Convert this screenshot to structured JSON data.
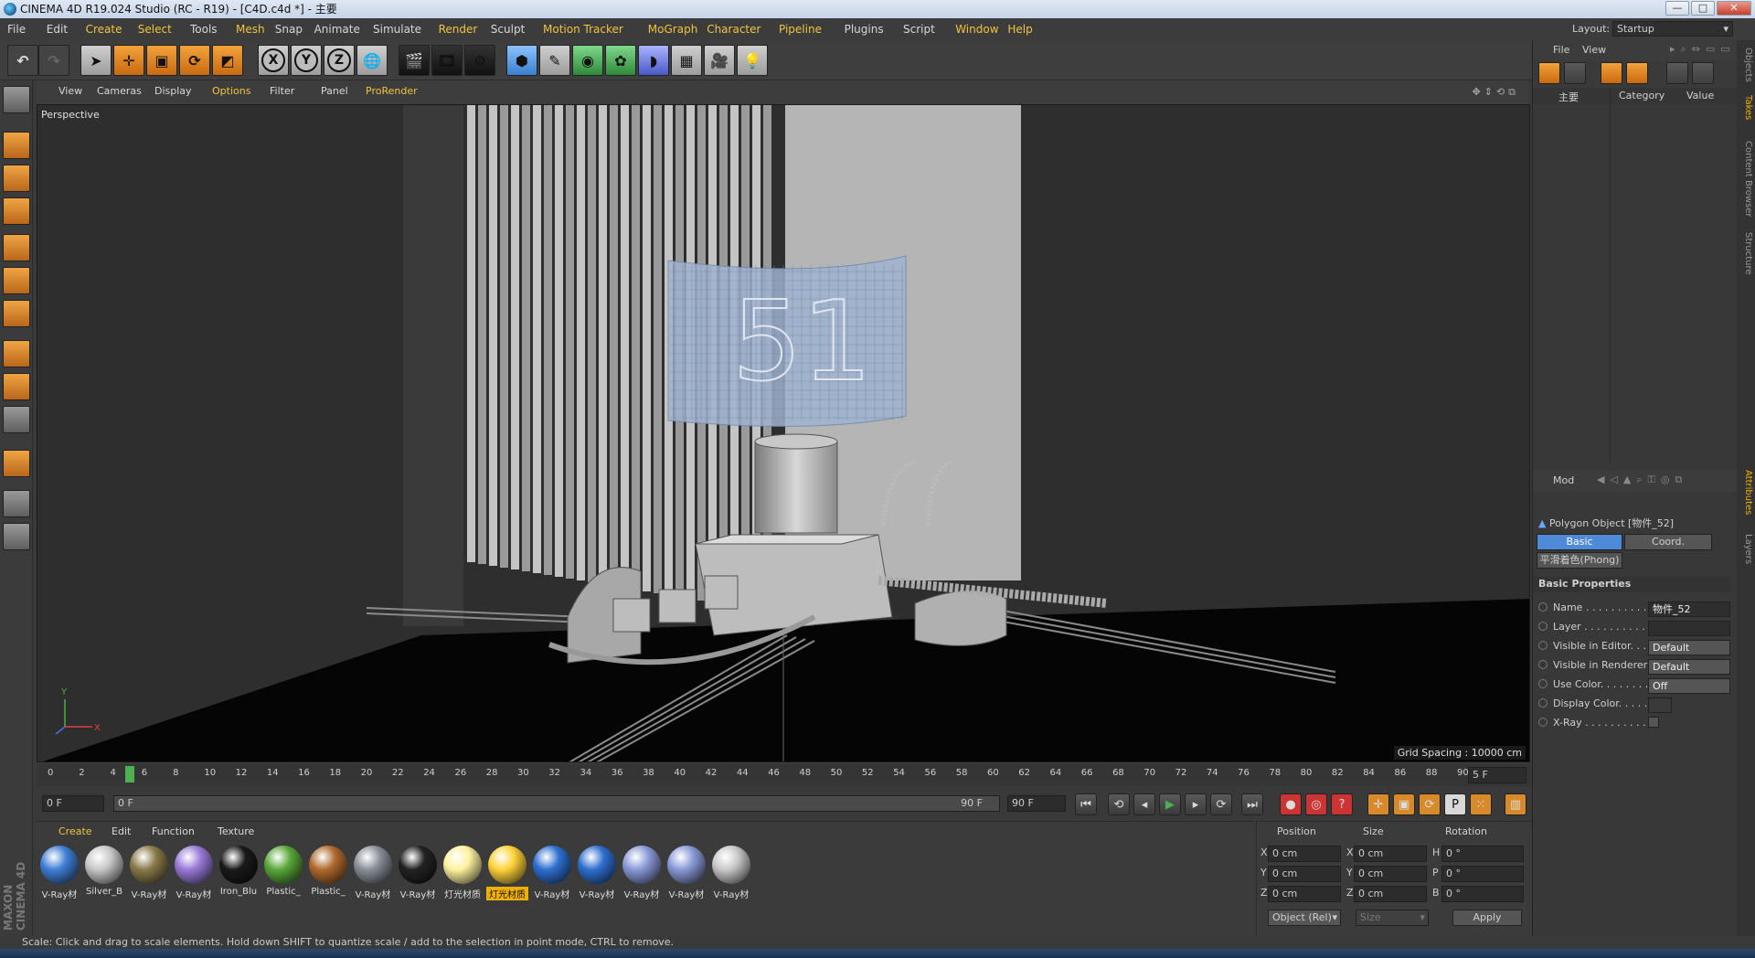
{
  "window": {
    "title": "CINEMA 4D R19.024 Studio (RC - R19) - [C4D.c4d *] - 主要",
    "minimize": "—",
    "maximize": "□",
    "close": "✕"
  },
  "menu": [
    "File",
    "Edit",
    "Create",
    "Select",
    "Tools",
    "Mesh",
    "Snap",
    "Animate",
    "Simulate",
    "Render",
    "Sculpt",
    "Motion Tracker",
    "MoGraph",
    "Character",
    "Pipeline",
    "Plugins",
    "Script",
    "Window",
    "Help"
  ],
  "menu_highlight": [
    "Create",
    "Select",
    "Mesh",
    "Render",
    "Motion Tracker",
    "MoGraph",
    "Character",
    "Pipeline",
    "Window",
    "Help"
  ],
  "layout": {
    "label": "Layout:",
    "value": "Startup"
  },
  "toolbar": {
    "axis_x": "X",
    "axis_y": "Y",
    "axis_z": "Z"
  },
  "viewport": {
    "menu": [
      "View",
      "Cameras",
      "Display",
      "Options",
      "Filter",
      "Panel",
      "ProRender"
    ],
    "menu_highlight": [
      "Options",
      "ProRender"
    ],
    "label": "Perspective",
    "grid_spacing": "Grid Spacing : 10000 cm",
    "axis_y": "Y",
    "axis_x": "X",
    "sign_text": "51"
  },
  "timeline": {
    "ticks": [
      "0",
      "2",
      "4",
      "6",
      "8",
      "10",
      "12",
      "14",
      "16",
      "18",
      "20",
      "22",
      "24",
      "26",
      "28",
      "30",
      "32",
      "34",
      "36",
      "38",
      "40",
      "42",
      "44",
      "46",
      "48",
      "50",
      "52",
      "54",
      "56",
      "58",
      "60",
      "62",
      "64",
      "66",
      "68",
      "70",
      "72",
      "74",
      "76",
      "78",
      "80",
      "82",
      "84",
      "86",
      "88",
      "90"
    ],
    "current_marker": "5",
    "current_frame": "5 F",
    "progress": 0.055
  },
  "transport": {
    "start_field": "0 F",
    "range_start": "0 F",
    "range_end": "90 F",
    "end_field": "90 F"
  },
  "materials": {
    "menu": [
      "Create",
      "Edit",
      "Function",
      "Texture"
    ],
    "items": [
      {
        "label": "V-Ray材",
        "color": "#3f7fd6"
      },
      {
        "label": "Silver_B",
        "color": "#c8c8c8"
      },
      {
        "label": "V-Ray材",
        "color": "#8a7a4a"
      },
      {
        "label": "V-Ray材",
        "color": "#9a7ad8"
      },
      {
        "label": "Iron_Blu",
        "color": "#1a1a1a"
      },
      {
        "label": "Plastic_",
        "color": "#5aa83a"
      },
      {
        "label": "Plastic_",
        "color": "#b06a2e"
      },
      {
        "label": "V-Ray材",
        "color": "#8a8f99"
      },
      {
        "label": "V-Ray材",
        "color": "#222222"
      },
      {
        "label": "灯光材质",
        "color": "#fff2a0"
      },
      {
        "label": "灯光材质",
        "color": "#ffd23a"
      },
      {
        "label": "V-Ray材",
        "color": "#2e6fd0"
      },
      {
        "label": "V-Ray材",
        "color": "#2e6fd0"
      },
      {
        "label": "V-Ray材",
        "color": "#8a9ad8"
      },
      {
        "label": "V-Ray材",
        "color": "#8a9ad8"
      },
      {
        "label": "V-Ray材",
        "color": "#c8c8c8"
      }
    ]
  },
  "coords": {
    "headers": [
      "Position",
      "Size",
      "Rotation"
    ],
    "rows": [
      {
        "axis": "X",
        "pos": "0 cm",
        "size_axis": "X",
        "size": "0 cm",
        "rot_axis": "H",
        "rot": "0 °"
      },
      {
        "axis": "Y",
        "pos": "0 cm",
        "size_axis": "Y",
        "size": "0 cm",
        "rot_axis": "P",
        "rot": "0 °"
      },
      {
        "axis": "Z",
        "pos": "0 cm",
        "size_axis": "Z",
        "size": "0 cm",
        "rot_axis": "B",
        "rot": "0 °"
      }
    ],
    "mode": "Object (Rel)",
    "size_mode": "Size",
    "apply": "Apply"
  },
  "objects": {
    "menu": [
      "File",
      "View"
    ],
    "take": "主要",
    "category": "Category",
    "value": "Value"
  },
  "attributes": {
    "mode": "Mod",
    "object": "Polygon Object [物件_52]",
    "tabs": [
      "Basic",
      "Coord."
    ],
    "phong": "平滑着色(Phong)",
    "section": "Basic Properties",
    "rows": [
      {
        "label": "Name . . . . . . . . . . .",
        "value": "物件_52"
      },
      {
        "label": "Layer . . . . . . . . . . .",
        "value": ""
      },
      {
        "label": "Visible in Editor. . .",
        "value": "Default"
      },
      {
        "label": "Visible in Renderer",
        "value": "Default"
      },
      {
        "label": "Use Color. . . . . . . .",
        "value": "Off"
      },
      {
        "label": "Display Color. . . . .",
        "value": ""
      },
      {
        "label": "X-Ray . . . . . . . . . .",
        "value": ""
      }
    ]
  },
  "sidetabs": [
    "Objects",
    "Takes",
    "Content Browser",
    "Structure",
    "Attributes",
    "Layers"
  ],
  "status": "Scale: Click and drag to scale elements. Hold down SHIFT to quantize scale / add to the selection in point mode, CTRL to remove.",
  "brand": "MAXON CINEMA 4D"
}
